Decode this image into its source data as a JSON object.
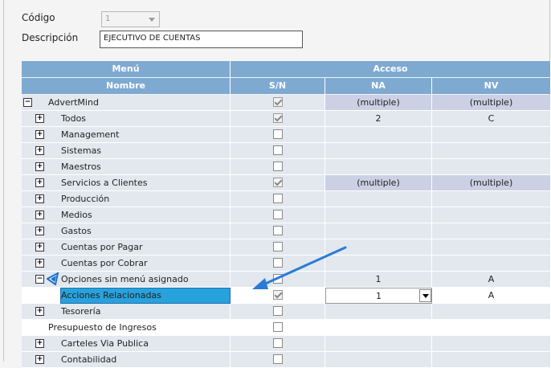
{
  "form": {
    "codigo_label": "Código",
    "codigo_value": "1",
    "descripcion_label": "Descripción",
    "descripcion_value": "EJECUTIVO DE CUENTAS"
  },
  "grid": {
    "header_group": {
      "menu": "Menú",
      "acceso": "Acceso"
    },
    "header_cols": {
      "nombre": "Nombre",
      "sn": "S/N",
      "na": "NA",
      "nv": "NV"
    },
    "rows": [
      {
        "toggle": "−",
        "name": "AdvertMind",
        "checked": true,
        "na": "(multiple)",
        "nv": "(multiple)"
      },
      {
        "toggle": "+",
        "name": "Todos",
        "checked": true,
        "na": "2",
        "nv": "C"
      },
      {
        "toggle": "+",
        "name": "Management",
        "checked": false,
        "na": "",
        "nv": ""
      },
      {
        "toggle": "+",
        "name": "Sistemas",
        "checked": false,
        "na": "",
        "nv": ""
      },
      {
        "toggle": "+",
        "name": "Maestros",
        "checked": false,
        "na": "",
        "nv": ""
      },
      {
        "toggle": "+",
        "name": "Servicios a Clientes",
        "checked": true,
        "na": "(multiple)",
        "nv": "(multiple)"
      },
      {
        "toggle": "+",
        "name": "Producción",
        "checked": false,
        "na": "",
        "nv": ""
      },
      {
        "toggle": "+",
        "name": "Medios",
        "checked": false,
        "na": "",
        "nv": ""
      },
      {
        "toggle": "+",
        "name": "Gastos",
        "checked": false,
        "na": "",
        "nv": ""
      },
      {
        "toggle": "+",
        "name": "Cuentas por Pagar",
        "checked": false,
        "na": "",
        "nv": ""
      },
      {
        "toggle": "+",
        "name": "Cuentas por Cobrar",
        "checked": false,
        "na": "",
        "nv": ""
      },
      {
        "toggle": "−",
        "name": "Opciones sin menú asignado",
        "checked": false,
        "na": "1",
        "nv": "A"
      },
      {
        "toggle": "",
        "name": "Acciones Relacionadas",
        "checked": true,
        "na": "1",
        "nv": "A"
      },
      {
        "toggle": "+",
        "name": "Tesorería",
        "checked": false,
        "na": "",
        "nv": ""
      },
      {
        "toggle": "",
        "name": "Presupuesto de Ingresos",
        "checked": false,
        "na": "",
        "nv": ""
      },
      {
        "toggle": "+",
        "name": "Carteles Via Publica",
        "checked": false,
        "na": "",
        "nv": ""
      },
      {
        "toggle": "+",
        "name": "Contabilidad",
        "checked": false,
        "na": "",
        "nv": ""
      }
    ]
  },
  "colors": {
    "header": "#7eaad2",
    "row": "#e2e8ee",
    "multiple": "#ccd0e4",
    "selected": "#28a2dc",
    "arrow": "#2a7bd8"
  }
}
